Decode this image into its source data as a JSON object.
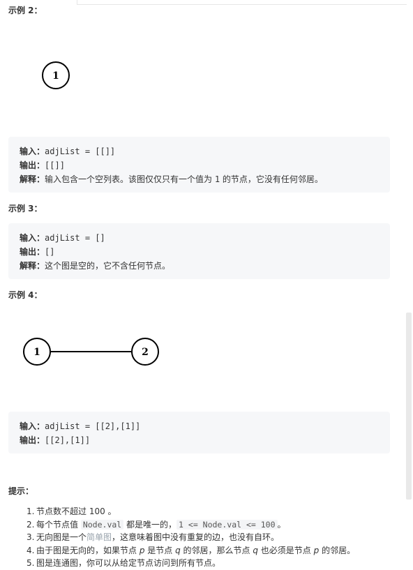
{
  "example2": {
    "title": "示例 2：",
    "node_label": "1",
    "input_label": "输入：",
    "input_value": "adjList = [[]]",
    "output_label": "输出：",
    "output_value": "[[]]",
    "explain_label": "解释：",
    "explain_text_a": "输入包含一个空列表。该图仅仅只有一个值为 ",
    "explain_code": "1",
    "explain_text_b": " 的节点，它没有任何邻居。"
  },
  "example3": {
    "title": "示例 3：",
    "input_label": "输入：",
    "input_value": "adjList = []",
    "output_label": "输出：",
    "output_value": "[]",
    "explain_label": "解释：",
    "explain_text": "这个图是空的，它不含任何节点。"
  },
  "example4": {
    "title": "示例 4：",
    "node_a": "1",
    "node_b": "2",
    "input_label": "输入：",
    "input_value": "adjList = [[2],[1]]",
    "output_label": "输出：",
    "output_value": "[[2],[1]]"
  },
  "hints": {
    "title": "提示：",
    "items": [
      {
        "num": "1.",
        "text": "节点数不超过 100 。"
      },
      {
        "num": "2.",
        "pre": "每个节点值 ",
        "code1": "Node.val",
        "mid": " 都是唯一的，",
        "code2": "1 <= Node.val <= 100",
        "post": "。"
      },
      {
        "num": "3.",
        "pre": "无向图是一个",
        "link": "简单图",
        "post": "，这意味着图中没有重复的边，也没有自环。"
      },
      {
        "num": "4.",
        "pre": "由于图是无向的，如果节点 ",
        "p": "p",
        "mid1": " 是节点 ",
        "q": "q",
        "mid2": " 的邻居，那么节点 ",
        "q2": "q",
        "mid3": " 也必须是节点 ",
        "p2": "p",
        "post": " 的邻居。"
      },
      {
        "num": "5.",
        "text": "图是连通图，你可以从给定节点访问到所有节点。"
      }
    ]
  }
}
